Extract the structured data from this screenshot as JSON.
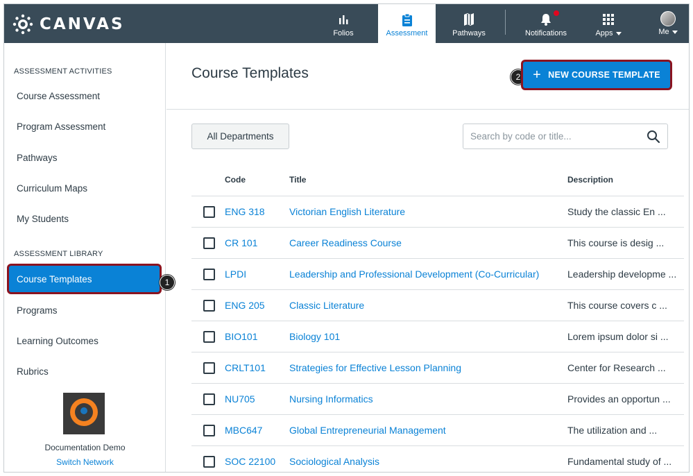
{
  "brand": {
    "name": "CANVAS"
  },
  "topnav": [
    {
      "key": "folios",
      "label": "Folios",
      "icon": "bar-chart-icon"
    },
    {
      "key": "assessment",
      "label": "Assessment",
      "icon": "clipboard-icon",
      "active": true
    },
    {
      "key": "pathways",
      "label": "Pathways",
      "icon": "map-icon"
    },
    {
      "key": "notifications",
      "label": "Notifications",
      "icon": "bell-icon"
    },
    {
      "key": "apps",
      "label": "Apps",
      "icon": "grid-icon"
    },
    {
      "key": "me",
      "label": "Me",
      "icon": "avatar"
    }
  ],
  "sidebar": {
    "activities_heading": "ASSESSMENT ACTIVITIES",
    "activities": [
      "Course Assessment",
      "Program Assessment",
      "Pathways",
      "Curriculum Maps",
      "My Students"
    ],
    "library_heading": "ASSESSMENT LIBRARY",
    "library": [
      "Course Templates",
      "Programs",
      "Learning Outcomes",
      "Rubrics"
    ],
    "org_name": "Documentation Demo",
    "switch_label": "Switch Network"
  },
  "callouts": {
    "one": "1",
    "two": "2"
  },
  "main": {
    "title": "Course Templates",
    "new_button": "NEW COURSE TEMPLATE",
    "department_filter": "All Departments",
    "search_placeholder": "Search by code or title..."
  },
  "table": {
    "headers": {
      "code": "Code",
      "title": "Title",
      "description": "Description"
    },
    "rows": [
      {
        "code": "ENG 318",
        "title": "Victorian English Literature",
        "description": "Study the classic En ..."
      },
      {
        "code": "CR 101",
        "title": "Career Readiness Course",
        "description": "This course is desig ..."
      },
      {
        "code": "LPDI",
        "title": "Leadership and Professional Development (Co-Curricular)",
        "description": "Leadership developme ..."
      },
      {
        "code": "ENG 205",
        "title": "Classic Literature",
        "description": "This course covers c ..."
      },
      {
        "code": "BIO101",
        "title": "Biology 101",
        "description": "Lorem ipsum dolor si ..."
      },
      {
        "code": "CRLT101",
        "title": "Strategies for Effective Lesson Planning",
        "description": "Center for Research ..."
      },
      {
        "code": "NU705",
        "title": "Nursing Informatics",
        "description": "Provides an opportun ..."
      },
      {
        "code": "MBC647",
        "title": "Global Entrepreneurial Management",
        "description": "The utilization and ..."
      },
      {
        "code": "SOC 22100",
        "title": "Sociological Analysis",
        "description": "Fundamental study of ..."
      }
    ]
  },
  "colors": {
    "nav_bg": "#394b58",
    "accent": "#0a82d6",
    "highlight_border": "#8b1420",
    "notification_dot": "#e0061f"
  }
}
